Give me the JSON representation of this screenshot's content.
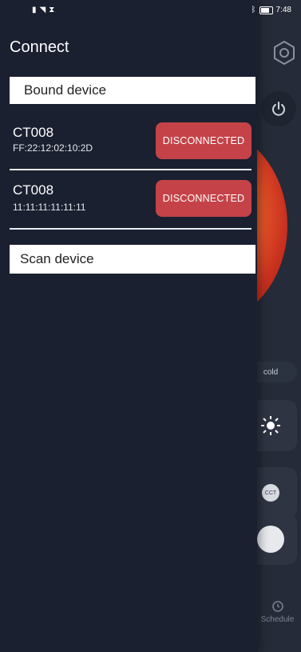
{
  "status_bar": {
    "left_icons": [
      "sim-icon",
      "wifi-icon",
      "hourglass-icon"
    ],
    "right_icons": [
      "bluetooth-icon",
      "battery-icon"
    ],
    "time": "7:48"
  },
  "drawer": {
    "title": "Connect",
    "bound_section": {
      "label": "Bound device"
    },
    "devices": [
      {
        "name": "CT008",
        "mac": "FF:22:12:02:10:2D",
        "button": "DISCONNECTED"
      },
      {
        "name": "CT008",
        "mac": "11:11:11:11:11:11",
        "button": "DISCONNECTED"
      }
    ],
    "scan_section": {
      "label": "Scan device"
    }
  },
  "background_app": {
    "cold_label": "cold",
    "cct_label": "CCT",
    "schedule_label": "Schedule"
  },
  "colors": {
    "drawer_bg": "#1a2030",
    "button_red": "#c54348",
    "section_bg": "#ffffff"
  }
}
